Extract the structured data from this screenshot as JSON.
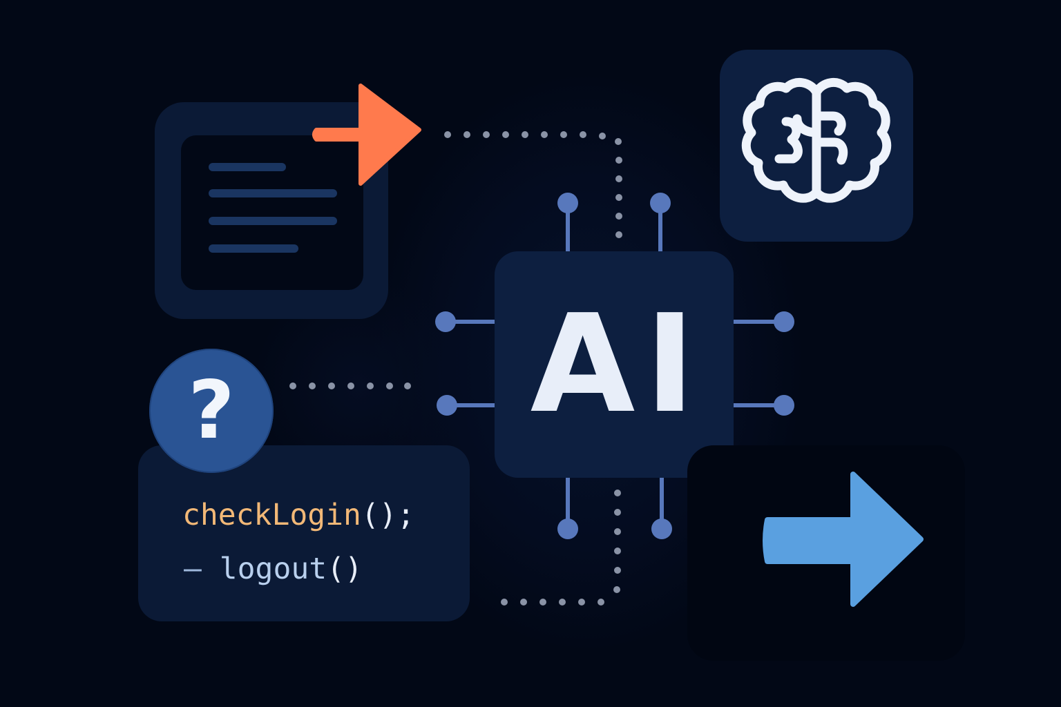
{
  "chip": {
    "label": "AI"
  },
  "question_bubble": {
    "symbol": "?"
  },
  "code": {
    "line1_name": "checkLogin",
    "line1_punct": "();",
    "line2_dash": "–",
    "line2_name": "logout",
    "line2_punct": "()"
  },
  "icons": {
    "document": "document-icon",
    "brain": "brain-icon",
    "arrow_orange": "arrow-right-icon",
    "arrow_blue": "arrow-right-icon"
  },
  "colors": {
    "background": "#020816",
    "card": "#0d1f40",
    "orange_arrow": "#ff7a4d",
    "blue_arrow": "#5aa0e0",
    "connector": "#5878bc",
    "code_function": "#f2b877",
    "code_logout": "#b9d0ee",
    "question": "#2a5494"
  }
}
